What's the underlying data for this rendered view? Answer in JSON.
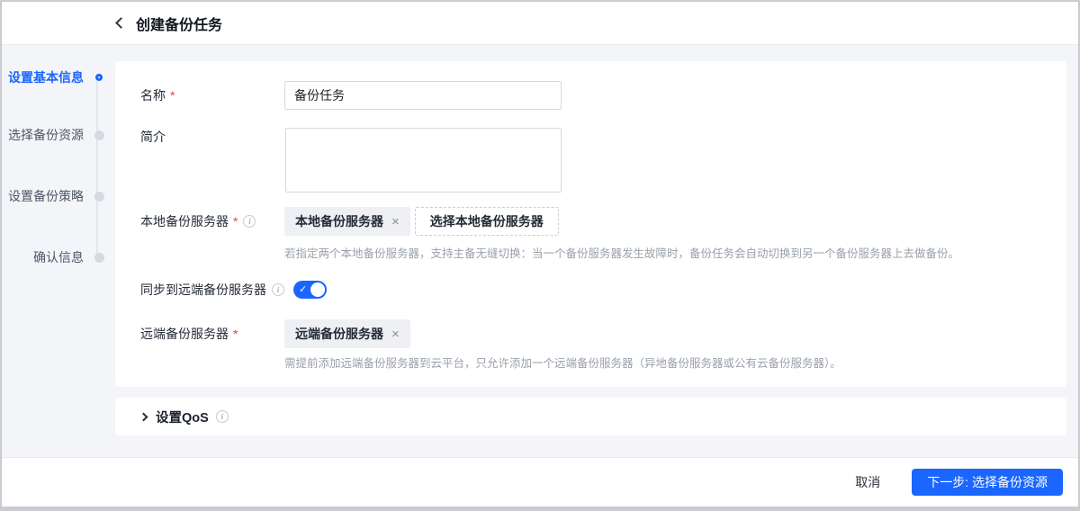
{
  "header": {
    "title": "创建备份任务"
  },
  "steps": [
    {
      "label": "设置基本信息",
      "state": "active"
    },
    {
      "label": "选择备份资源",
      "state": "upcoming"
    },
    {
      "label": "设置备份策略",
      "state": "upcoming"
    },
    {
      "label": "确认信息",
      "state": "upcoming"
    }
  ],
  "form": {
    "required_marker": "*",
    "name": {
      "label": "名称",
      "value": "备份任务"
    },
    "description": {
      "label": "简介",
      "value": ""
    },
    "local_server": {
      "label": "本地备份服务器",
      "selected_tag": "本地备份服务器",
      "select_button_label": "选择本地备份服务器",
      "help": "若指定两个本地备份服务器，支持主备无缝切换：当一个备份服务器发生故障时，备份任务会自动切换到另一个备份服务器上去做备份。"
    },
    "sync_remote": {
      "label": "同步到远端备份服务器",
      "enabled": true
    },
    "remote_server": {
      "label": "远端备份服务器",
      "selected_tag": "远端备份服务器",
      "help": "需提前添加远端备份服务器到云平台，只允许添加一个远端备份服务器（异地备份服务器或公有云备份服务器）。"
    }
  },
  "qos": {
    "label": "设置QoS"
  },
  "footer": {
    "cancel_label": "取消",
    "next_label": "下一步: 选择备份资源"
  },
  "icons": {
    "close": "×",
    "check": "✓",
    "info": "i"
  },
  "colors": {
    "accent_blue": "#1a66ff",
    "required_red": "#f03e3e",
    "page_background": "#f3f5f9"
  }
}
